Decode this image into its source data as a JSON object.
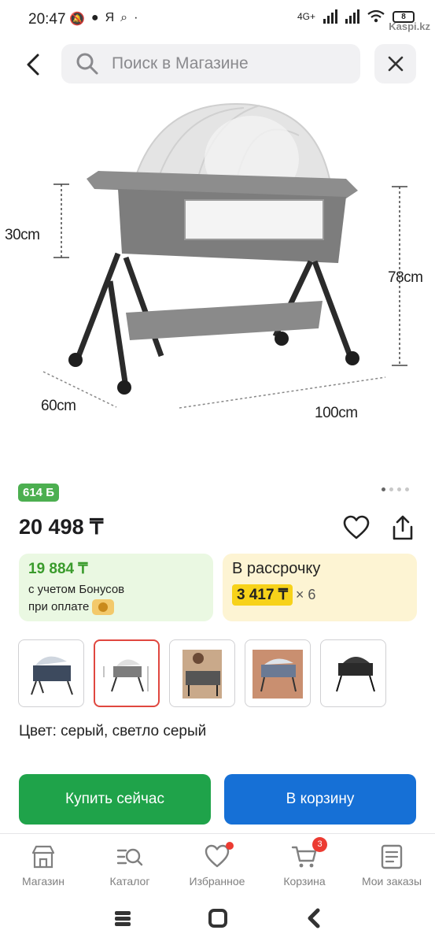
{
  "status_bar": {
    "time": "20:47",
    "network": "4G+",
    "battery": "8",
    "watermark": "Kaspi.kz"
  },
  "search": {
    "placeholder": "Поиск в Магазине"
  },
  "product": {
    "dimension_labels": {
      "height_side": "30cm",
      "height_total": "78cm",
      "width": "60cm",
      "length": "100cm"
    },
    "bonus_badge": "614 Б",
    "image_count": 4,
    "active_image": 1,
    "price": "20 498 ₸",
    "bonus_price": "19 884 ₸",
    "bonus_note_line1": "с учетом Бонусов",
    "bonus_note_line2": "при оплате",
    "installment_title": "В рассрочку",
    "installment_price": "3 417 ₸",
    "installment_months": "× 6",
    "color_text": "Цвет: серый, светло серый"
  },
  "thumbnails": [
    {
      "id": "thumb-1",
      "selected": false
    },
    {
      "id": "thumb-2",
      "selected": true
    },
    {
      "id": "thumb-3",
      "selected": false
    },
    {
      "id": "thumb-4",
      "selected": false
    },
    {
      "id": "thumb-5",
      "selected": false
    }
  ],
  "actions": {
    "buy_now": "Купить сейчас",
    "add_to_cart": "В корзину"
  },
  "tabs": [
    {
      "label": "Магазин",
      "icon": "shop-icon"
    },
    {
      "label": "Каталог",
      "icon": "catalog-icon"
    },
    {
      "label": "Избранное",
      "icon": "heart-icon",
      "dot": true
    },
    {
      "label": "Корзина",
      "icon": "cart-icon",
      "badge": "3"
    },
    {
      "label": "Мои заказы",
      "icon": "orders-icon"
    }
  ],
  "colors": {
    "buy_green": "#1fa34a",
    "cart_blue": "#1670d6",
    "bonus_green": "#4caf50",
    "installment_yellow": "#f7d21a",
    "badge_red": "#ec3b32"
  }
}
